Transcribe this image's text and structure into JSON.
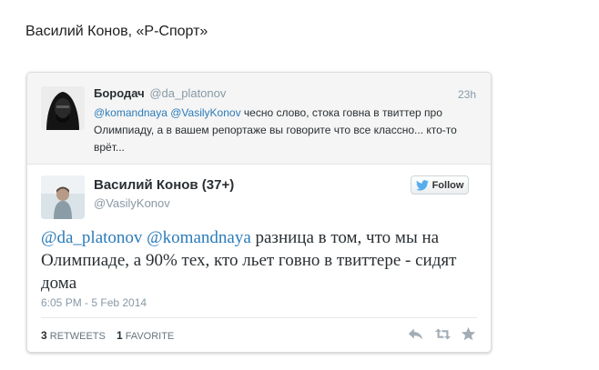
{
  "byline": "Василий Конов, «Р-Спорт»",
  "parent_tweet": {
    "name": "Бородач",
    "handle": "@da_platonov",
    "time": "23h",
    "mention1": "@komandnaya",
    "mention2": "@VasilyKonov",
    "text": "чесно слово, стока говна в твиттер про Олимпиаду, а в вашем репортаже вы говорите что все классно... кто-то врёт..."
  },
  "main_tweet": {
    "name": "Василий Конов (37+)",
    "handle": "@VasilyKonov",
    "follow_label": "Follow",
    "mention1": "@da_platonov",
    "mention2": "@komandnaya",
    "text": "разница в том, что мы на Олимпиаде, а 90% тех, кто льет говно в твиттере - сидят дома",
    "timestamp": "6:05 PM - 5 Feb 2014",
    "retweets_count": "3",
    "retweets_label": "RETWEETS",
    "favorites_count": "1",
    "favorites_label": "FAVORITE"
  },
  "icons": {
    "follow": "twitter-bird-icon",
    "reply": "reply-icon",
    "retweet": "retweet-icon",
    "favorite": "star-icon"
  },
  "colors": {
    "mention": "#2b7bb9",
    "twitter_blue": "#55acee",
    "muted": "#8899a6",
    "action_icon": "#a3adb5"
  }
}
